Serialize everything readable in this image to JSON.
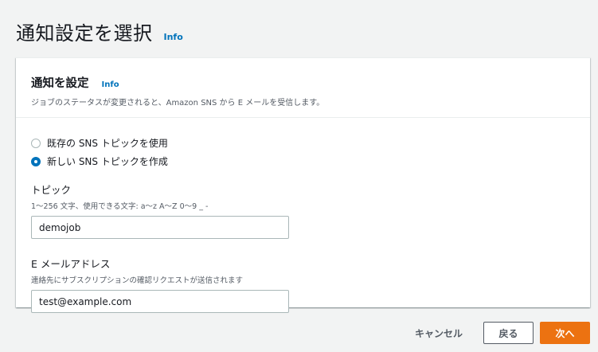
{
  "page": {
    "title": "通知設定を選択",
    "info_label": "Info"
  },
  "panel": {
    "title": "通知を設定",
    "info_label": "Info",
    "description": "ジョブのステータスが変更されると、Amazon SNS から E メールを受信します。",
    "options": [
      {
        "label": "既存の SNS トピックを使用",
        "selected": false
      },
      {
        "label": "新しい SNS トピックを作成",
        "selected": true
      }
    ],
    "topic": {
      "label": "トピック",
      "description": "1〜256 文字、使用できる文字: a〜z A〜Z 0〜9 _ -",
      "value": "demojob"
    },
    "email": {
      "label": "E メールアドレス",
      "description": "連絡先にサブスクリプションの確認リクエストが送信されます",
      "value": "test@example.com"
    }
  },
  "actions": {
    "cancel_label": "キャンセル",
    "back_label": "戻る",
    "next_label": "次へ"
  },
  "colors": {
    "accent": "#0073bb",
    "primary_button": "#ec7211"
  }
}
